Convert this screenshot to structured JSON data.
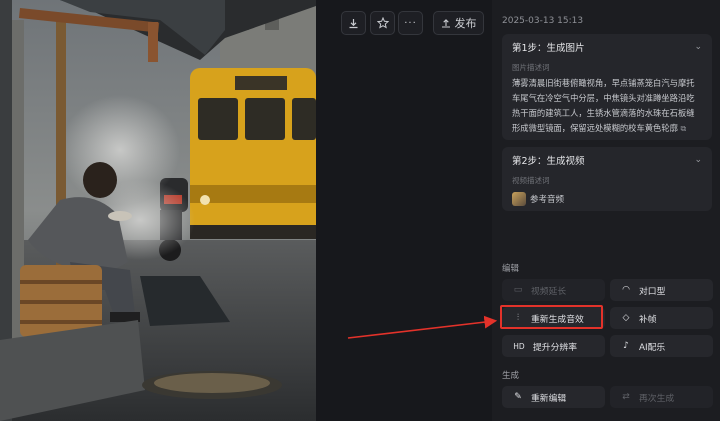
{
  "toolbar": {
    "download_icon": "download-icon",
    "favorite_icon": "star-icon",
    "more_icon": "more-icon",
    "publish_label": "发布"
  },
  "details": {
    "timestamp": "2025-03-13 15:13",
    "step1": {
      "title": "第1步：生成图片",
      "prompt_label": "图片描述词",
      "prompt": "薄雾清晨旧街巷俯瞰视角，早点铺蒸笼白汽与摩托车尾气在冷空气中分层，中焦镜头对准蹲坐路沿吃热干面的建筑工人，生锈水管滴落的水珠在石板缝形成微型镜面，保留远处模糊的校车黄色轮廓"
    },
    "step2": {
      "title": "第2步：生成视频",
      "prompt_label": "视频描述词",
      "reference_label": "参考音频"
    }
  },
  "edit": {
    "section_label": "编辑",
    "actions": [
      {
        "label": "视频延长",
        "icon": "extend-icon",
        "enabled": false
      },
      {
        "label": "对口型",
        "icon": "lip-sync-icon",
        "enabled": true
      },
      {
        "label": "重新生成音效",
        "icon": "sound-effects-icon",
        "enabled": true
      },
      {
        "label": "补帧",
        "icon": "frame-interpolation-icon",
        "enabled": true
      },
      {
        "label": "提升分辨率",
        "icon": "hd-icon",
        "icon_text": "HD",
        "enabled": true
      },
      {
        "label": "AI配乐",
        "icon": "music-icon",
        "enabled": true
      }
    ]
  },
  "generate": {
    "section_label": "生成",
    "actions": [
      {
        "label": "重新编辑",
        "icon": "pencil-icon",
        "enabled": true
      },
      {
        "label": "再次生成",
        "icon": "regenerate-icon",
        "enabled": false
      }
    ]
  },
  "annotation_color": "#e3322a"
}
